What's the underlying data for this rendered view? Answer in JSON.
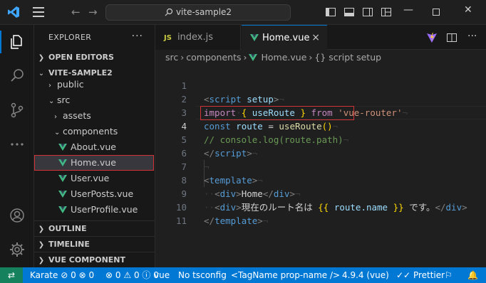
{
  "titlebar": {
    "search_text": "vite-sample2"
  },
  "sidebar": {
    "header": "EXPLORER",
    "more": "···",
    "sections": {
      "open_editors": "OPEN EDITORS",
      "project": "VITE-SAMPLE2",
      "outline": "OUTLINE",
      "timeline": "TIMELINE",
      "vue_preview": "VUE COMPONENT PREVIEW"
    },
    "tree": {
      "public": "public",
      "src": "src",
      "assets": "assets",
      "components": "components",
      "about": "About.vue",
      "home": "Home.vue",
      "user": "User.vue",
      "userposts": "UserPosts.vue",
      "userprofile": "UserProfile.vue"
    }
  },
  "tabs": {
    "tab1": {
      "badge": "JS",
      "label": "index.js"
    },
    "tab2": {
      "label": "Home.vue",
      "close": "×"
    }
  },
  "breadcrumb": {
    "part1": "src",
    "part2": "components",
    "part3": "Home.vue",
    "part4": "script setup"
  },
  "editor": {
    "line_numbers": [
      "1",
      "2",
      "3",
      "4",
      "5",
      "6",
      "7",
      "8",
      "9",
      "10",
      "11"
    ],
    "code": {
      "l1_open": "<",
      "l1_tag": "script",
      "l1_attr": " setup",
      "l1_close": ">",
      "l2_import": "import",
      "l2_b1": "{",
      "l2_id": " useRoute ",
      "l2_b2": "}",
      "l2_from": " from ",
      "l2_str": "'vue-router'",
      "l3_const": "const",
      "l3_id": " route ",
      "l3_eq": "= ",
      "l3_fn": "useRoute",
      "l3_paren": "()",
      "l4_comment": "// console.log(route.path)",
      "l5_open": "</",
      "l5_tag": "script",
      "l5_close": ">",
      "l6_ws": "¬",
      "l7_open": "<",
      "l7_tag": "template",
      "l7_close": ">",
      "l8_open": "<",
      "l8_tag": "div",
      "l8_close": ">",
      "l8_text": "Home",
      "l8_end_open": "</",
      "l8_end_tag": "div",
      "l8_end_close": ">",
      "l9_open": "<",
      "l9_tag": "div",
      "l9_close": ">",
      "l9_text": "現在のルート名は ",
      "l9_mo": "{{",
      "l9_expr": " route.name ",
      "l9_mc": "}}",
      "l9_text2": " です。",
      "l9_end_open": "</",
      "l9_end_tag": "div",
      "l9_end_close": ">",
      "l10_open": "</",
      "l10_tag": "template",
      "l10_close": ">"
    }
  },
  "statusbar": {
    "profile": "Karate",
    "errors1": "0",
    "warnings1": "0",
    "errors2": "0",
    "warnings2": "0",
    "info": "0",
    "language": "vue",
    "tsconfig": "No tsconfig",
    "tagname": "<TagName prop-name />",
    "version": "4.9.4 (vue)",
    "prettier": "Prettier"
  },
  "colors": {
    "accent": "#0078d4",
    "selection_outline": "#d13438",
    "vue_green": "#41b883"
  }
}
